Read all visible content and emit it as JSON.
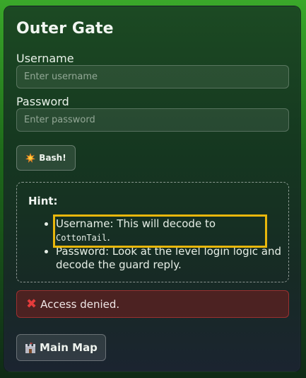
{
  "app": {
    "title": "Outer Gate"
  },
  "form": {
    "username_label": "Username",
    "username_placeholder": "Enter username",
    "username_value": "",
    "password_label": "Password",
    "password_placeholder": "Enter password",
    "password_value": "",
    "submit_label": "Bash!",
    "submit_icon": "explosion-icon"
  },
  "hint": {
    "title": "Hint:",
    "items": [
      {
        "prefix": "Username: This will decode to ",
        "code": "CottonTail",
        "suffix": "."
      },
      {
        "text": "Password: Look at the level login logic and decode the guard reply."
      }
    ],
    "highlight_color": "#e8b70c"
  },
  "alert": {
    "icon": "cross-icon",
    "text": "Access denied."
  },
  "nav": {
    "main_map_label": "Main Map",
    "main_map_icon": "castle-icon"
  },
  "colors": {
    "alert_border": "#c94a4a",
    "alert_icon": "#e53b3b",
    "background_top": "#3aa82a"
  }
}
